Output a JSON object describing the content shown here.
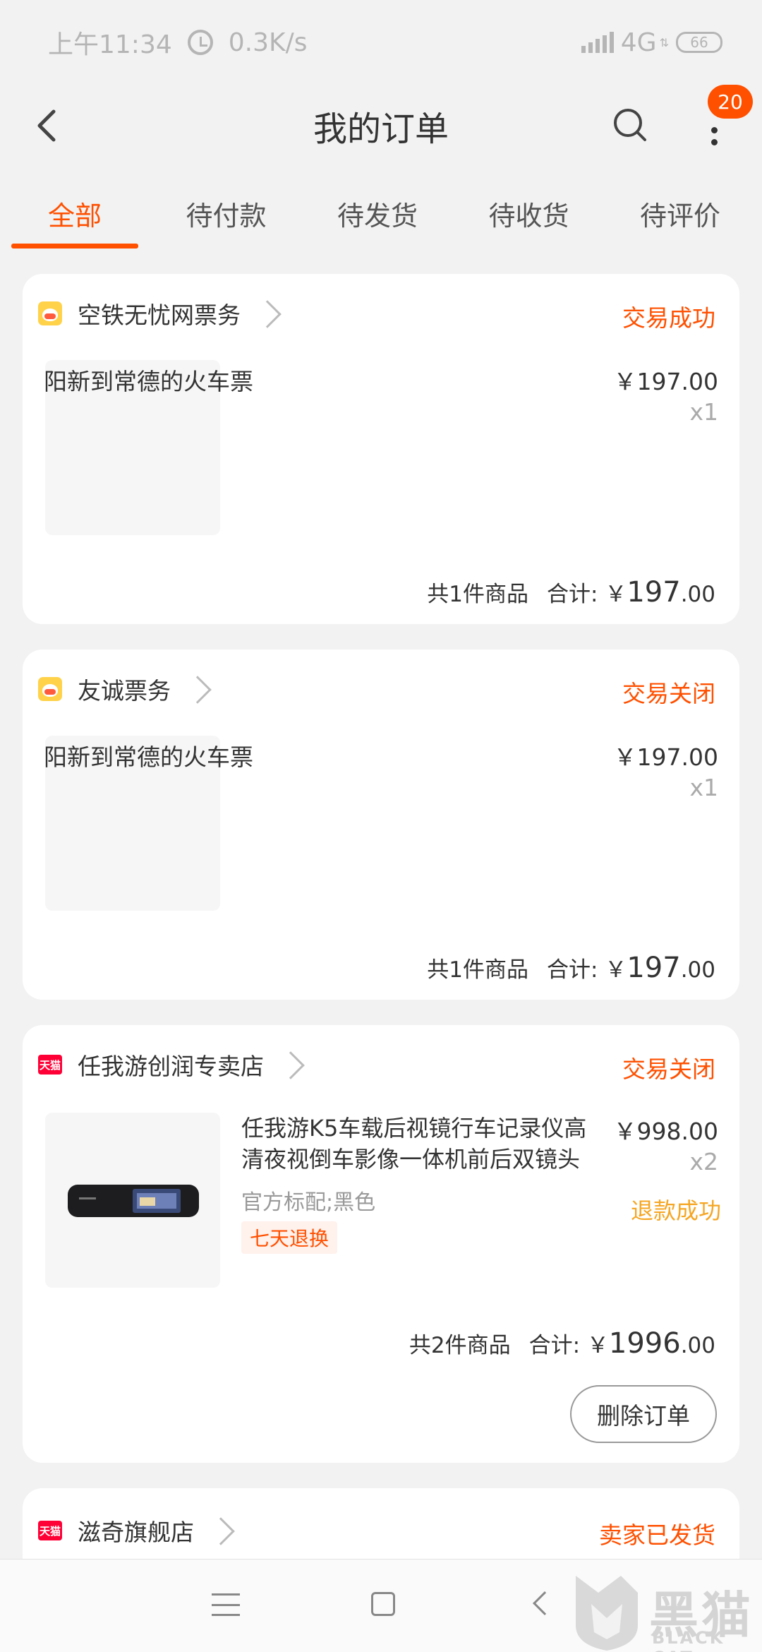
{
  "status_bar": {
    "time": "上午11:34",
    "speed": "0.3K/s",
    "network": "4G",
    "network_sup": "⇅",
    "battery": "66"
  },
  "header": {
    "title": "我的订单",
    "badge": "20"
  },
  "tabs": [
    {
      "label": "全部"
    },
    {
      "label": "待付款"
    },
    {
      "label": "待发货"
    },
    {
      "label": "待收货"
    },
    {
      "label": "待评价"
    }
  ],
  "orders": [
    {
      "shop": "空铁无忧网票务",
      "status": "交易成功",
      "item_title": "阳新到常德的火车票",
      "price": "￥197.00",
      "qty": "x1",
      "count_text": "共1件商品",
      "total_label": "合计: ￥",
      "total_int": "197",
      "total_dec": ".00"
    },
    {
      "shop": "友诚票务",
      "status": "交易关闭",
      "item_title": "阳新到常德的火车票",
      "price": "￥197.00",
      "qty": "x1",
      "count_text": "共1件商品",
      "total_label": "合计: ￥",
      "total_int": "197",
      "total_dec": ".00"
    },
    {
      "shop": "任我游创润专卖店",
      "shop_badge": "天猫",
      "status": "交易关闭",
      "item_title": "任我游K5车载后视镜行车记录仪高清夜视倒车影像一体机前后双镜头",
      "spec": "官方标配;黑色",
      "tag": "七天退换",
      "price": "￥998.00",
      "qty": "x2",
      "refund": "退款成功",
      "count_text": "共2件商品",
      "total_label": "合计: ￥",
      "total_int": "1996",
      "total_dec": ".00",
      "action": "删除订单"
    },
    {
      "shop": "滋奇旗舰店",
      "shop_badge": "天猫",
      "status": "卖家已发货"
    }
  ],
  "watermark": {
    "text": "黑猫",
    "sub": "BLACK CAT"
  },
  "colors": {
    "accent": "#ff5000",
    "refund": "#f5a623",
    "background": "#f2f2f2"
  },
  "icons": [
    "back-icon",
    "search-icon",
    "more-icon",
    "alarm-icon",
    "signal-icon",
    "battery-icon",
    "chevron-right-icon",
    "shop-icon",
    "tmall-icon",
    "menu-icon",
    "home-icon",
    "nav-back-icon"
  ]
}
